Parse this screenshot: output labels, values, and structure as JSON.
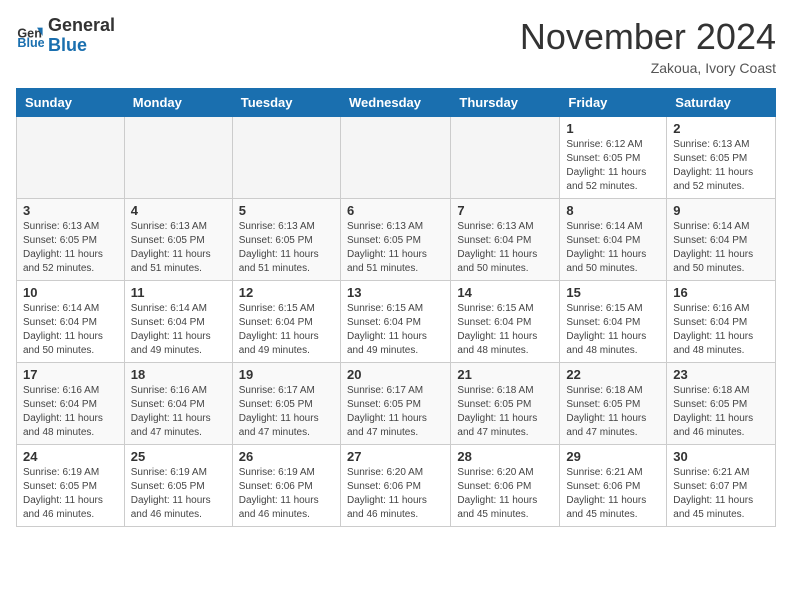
{
  "logo": {
    "line1": "General",
    "line2": "Blue",
    "icon_color": "#1a6faf"
  },
  "header": {
    "month_year": "November 2024",
    "location": "Zakoua, Ivory Coast"
  },
  "days_of_week": [
    "Sunday",
    "Monday",
    "Tuesday",
    "Wednesday",
    "Thursday",
    "Friday",
    "Saturday"
  ],
  "weeks": [
    [
      {
        "day": "",
        "empty": true
      },
      {
        "day": "",
        "empty": true
      },
      {
        "day": "",
        "empty": true
      },
      {
        "day": "",
        "empty": true
      },
      {
        "day": "",
        "empty": true
      },
      {
        "day": "1",
        "sunrise": "Sunrise: 6:12 AM",
        "sunset": "Sunset: 6:05 PM",
        "daylight": "Daylight: 11 hours and 52 minutes."
      },
      {
        "day": "2",
        "sunrise": "Sunrise: 6:13 AM",
        "sunset": "Sunset: 6:05 PM",
        "daylight": "Daylight: 11 hours and 52 minutes."
      }
    ],
    [
      {
        "day": "3",
        "sunrise": "Sunrise: 6:13 AM",
        "sunset": "Sunset: 6:05 PM",
        "daylight": "Daylight: 11 hours and 52 minutes."
      },
      {
        "day": "4",
        "sunrise": "Sunrise: 6:13 AM",
        "sunset": "Sunset: 6:05 PM",
        "daylight": "Daylight: 11 hours and 51 minutes."
      },
      {
        "day": "5",
        "sunrise": "Sunrise: 6:13 AM",
        "sunset": "Sunset: 6:05 PM",
        "daylight": "Daylight: 11 hours and 51 minutes."
      },
      {
        "day": "6",
        "sunrise": "Sunrise: 6:13 AM",
        "sunset": "Sunset: 6:05 PM",
        "daylight": "Daylight: 11 hours and 51 minutes."
      },
      {
        "day": "7",
        "sunrise": "Sunrise: 6:13 AM",
        "sunset": "Sunset: 6:04 PM",
        "daylight": "Daylight: 11 hours and 50 minutes."
      },
      {
        "day": "8",
        "sunrise": "Sunrise: 6:14 AM",
        "sunset": "Sunset: 6:04 PM",
        "daylight": "Daylight: 11 hours and 50 minutes."
      },
      {
        "day": "9",
        "sunrise": "Sunrise: 6:14 AM",
        "sunset": "Sunset: 6:04 PM",
        "daylight": "Daylight: 11 hours and 50 minutes."
      }
    ],
    [
      {
        "day": "10",
        "sunrise": "Sunrise: 6:14 AM",
        "sunset": "Sunset: 6:04 PM",
        "daylight": "Daylight: 11 hours and 50 minutes."
      },
      {
        "day": "11",
        "sunrise": "Sunrise: 6:14 AM",
        "sunset": "Sunset: 6:04 PM",
        "daylight": "Daylight: 11 hours and 49 minutes."
      },
      {
        "day": "12",
        "sunrise": "Sunrise: 6:15 AM",
        "sunset": "Sunset: 6:04 PM",
        "daylight": "Daylight: 11 hours and 49 minutes."
      },
      {
        "day": "13",
        "sunrise": "Sunrise: 6:15 AM",
        "sunset": "Sunset: 6:04 PM",
        "daylight": "Daylight: 11 hours and 49 minutes."
      },
      {
        "day": "14",
        "sunrise": "Sunrise: 6:15 AM",
        "sunset": "Sunset: 6:04 PM",
        "daylight": "Daylight: 11 hours and 48 minutes."
      },
      {
        "day": "15",
        "sunrise": "Sunrise: 6:15 AM",
        "sunset": "Sunset: 6:04 PM",
        "daylight": "Daylight: 11 hours and 48 minutes."
      },
      {
        "day": "16",
        "sunrise": "Sunrise: 6:16 AM",
        "sunset": "Sunset: 6:04 PM",
        "daylight": "Daylight: 11 hours and 48 minutes."
      }
    ],
    [
      {
        "day": "17",
        "sunrise": "Sunrise: 6:16 AM",
        "sunset": "Sunset: 6:04 PM",
        "daylight": "Daylight: 11 hours and 48 minutes."
      },
      {
        "day": "18",
        "sunrise": "Sunrise: 6:16 AM",
        "sunset": "Sunset: 6:04 PM",
        "daylight": "Daylight: 11 hours and 47 minutes."
      },
      {
        "day": "19",
        "sunrise": "Sunrise: 6:17 AM",
        "sunset": "Sunset: 6:05 PM",
        "daylight": "Daylight: 11 hours and 47 minutes."
      },
      {
        "day": "20",
        "sunrise": "Sunrise: 6:17 AM",
        "sunset": "Sunset: 6:05 PM",
        "daylight": "Daylight: 11 hours and 47 minutes."
      },
      {
        "day": "21",
        "sunrise": "Sunrise: 6:18 AM",
        "sunset": "Sunset: 6:05 PM",
        "daylight": "Daylight: 11 hours and 47 minutes."
      },
      {
        "day": "22",
        "sunrise": "Sunrise: 6:18 AM",
        "sunset": "Sunset: 6:05 PM",
        "daylight": "Daylight: 11 hours and 47 minutes."
      },
      {
        "day": "23",
        "sunrise": "Sunrise: 6:18 AM",
        "sunset": "Sunset: 6:05 PM",
        "daylight": "Daylight: 11 hours and 46 minutes."
      }
    ],
    [
      {
        "day": "24",
        "sunrise": "Sunrise: 6:19 AM",
        "sunset": "Sunset: 6:05 PM",
        "daylight": "Daylight: 11 hours and 46 minutes."
      },
      {
        "day": "25",
        "sunrise": "Sunrise: 6:19 AM",
        "sunset": "Sunset: 6:05 PM",
        "daylight": "Daylight: 11 hours and 46 minutes."
      },
      {
        "day": "26",
        "sunrise": "Sunrise: 6:19 AM",
        "sunset": "Sunset: 6:06 PM",
        "daylight": "Daylight: 11 hours and 46 minutes."
      },
      {
        "day": "27",
        "sunrise": "Sunrise: 6:20 AM",
        "sunset": "Sunset: 6:06 PM",
        "daylight": "Daylight: 11 hours and 46 minutes."
      },
      {
        "day": "28",
        "sunrise": "Sunrise: 6:20 AM",
        "sunset": "Sunset: 6:06 PM",
        "daylight": "Daylight: 11 hours and 45 minutes."
      },
      {
        "day": "29",
        "sunrise": "Sunrise: 6:21 AM",
        "sunset": "Sunset: 6:06 PM",
        "daylight": "Daylight: 11 hours and 45 minutes."
      },
      {
        "day": "30",
        "sunrise": "Sunrise: 6:21 AM",
        "sunset": "Sunset: 6:07 PM",
        "daylight": "Daylight: 11 hours and 45 minutes."
      }
    ]
  ]
}
